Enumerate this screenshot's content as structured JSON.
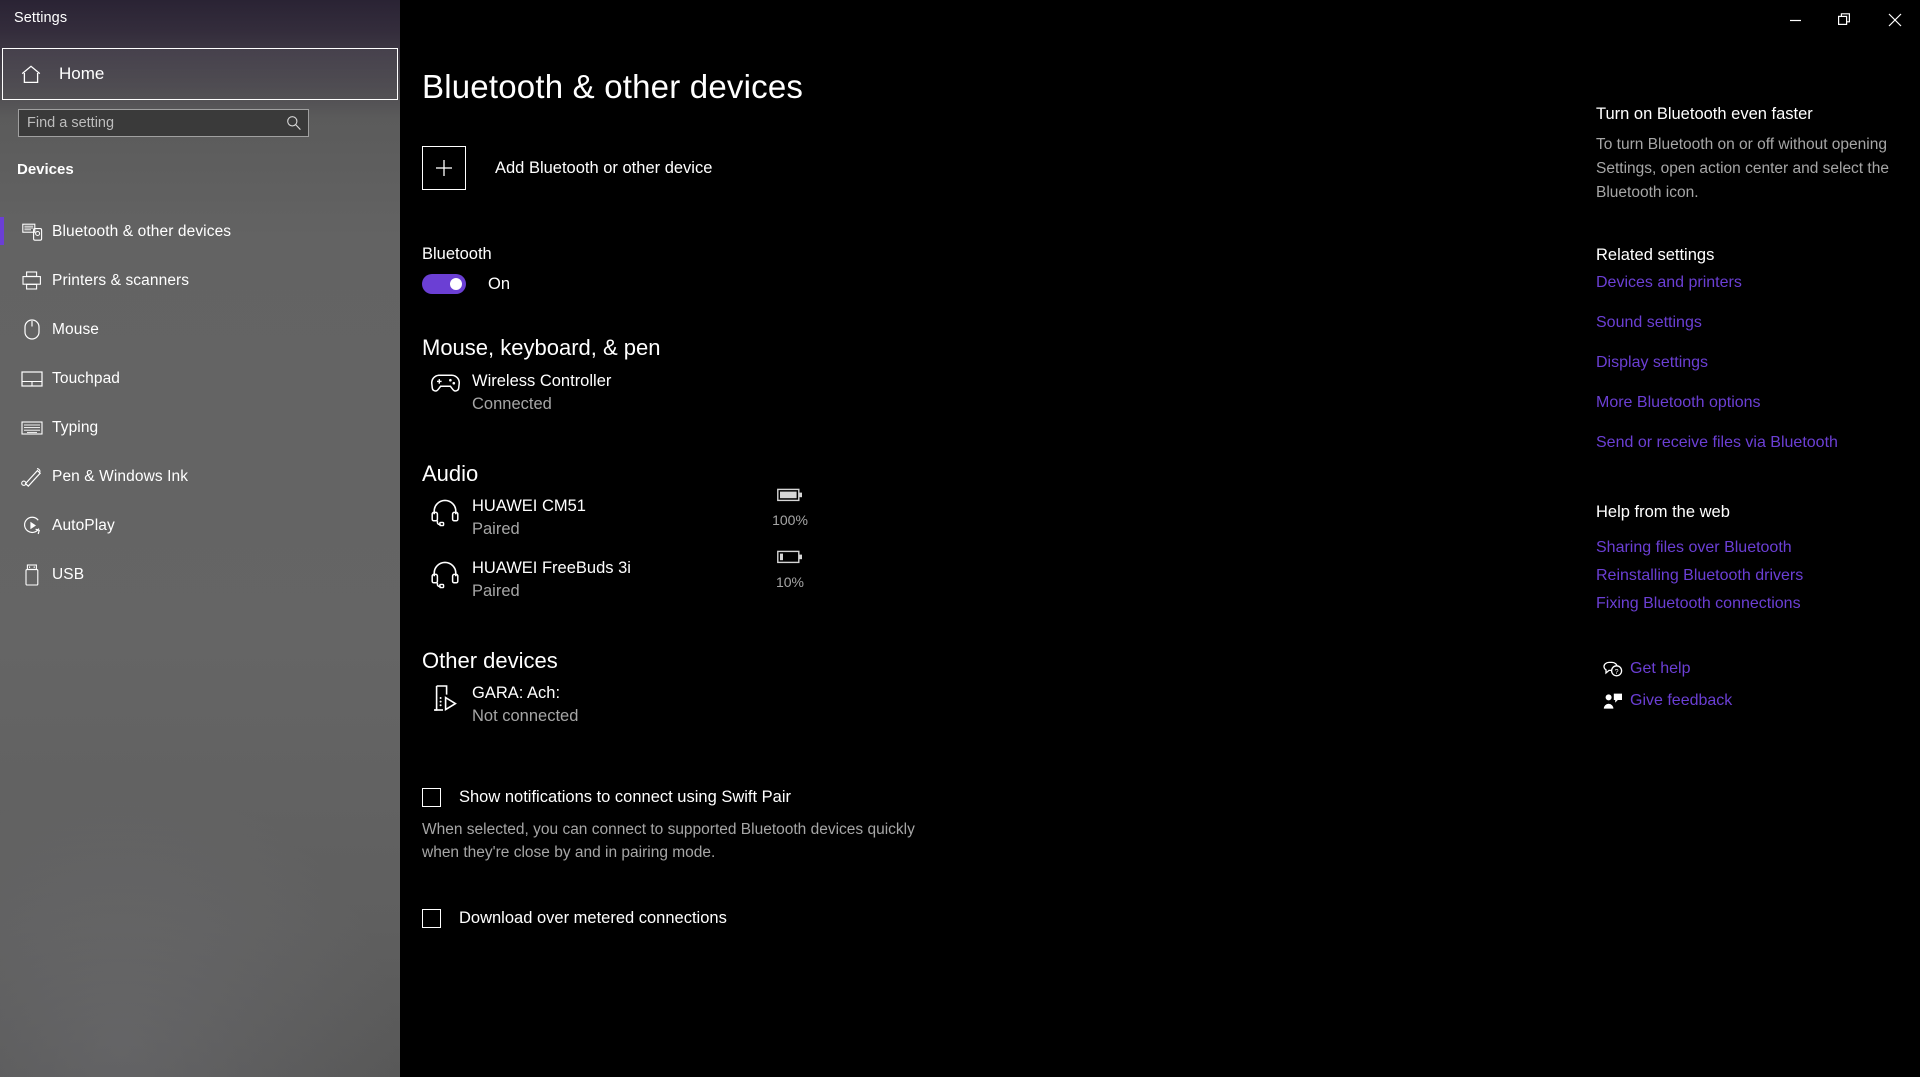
{
  "window": {
    "title": "Settings",
    "controls": [
      {
        "name": "minimize",
        "glyph": "minimize-icon"
      },
      {
        "name": "maximize",
        "glyph": "restore-icon"
      },
      {
        "name": "close",
        "glyph": "close-icon"
      }
    ]
  },
  "sidebar": {
    "home_label": "Home",
    "search_placeholder": "Find a setting",
    "search_value": "",
    "section_title": "Devices",
    "accent_color": "#6b3fd4",
    "items": [
      {
        "label": "Bluetooth & other devices",
        "icon": "bluetooth-devices-icon",
        "selected": true
      },
      {
        "label": "Printers & scanners",
        "icon": "printer-icon",
        "selected": false
      },
      {
        "label": "Mouse",
        "icon": "mouse-icon",
        "selected": false
      },
      {
        "label": "Touchpad",
        "icon": "touchpad-icon",
        "selected": false
      },
      {
        "label": "Typing",
        "icon": "keyboard-icon",
        "selected": false
      },
      {
        "label": "Pen & Windows Ink",
        "icon": "pen-icon",
        "selected": false
      },
      {
        "label": "AutoPlay",
        "icon": "autoplay-icon",
        "selected": false
      },
      {
        "label": "USB",
        "icon": "usb-icon",
        "selected": false
      }
    ]
  },
  "main": {
    "page_title": "Bluetooth & other devices",
    "add_device_label": "Add Bluetooth or other device",
    "bluetooth_label": "Bluetooth",
    "bluetooth_state": "On",
    "groups": [
      {
        "heading": "Mouse, keyboard, & pen",
        "devices": [
          {
            "name": "Wireless Controller",
            "status": "Connected",
            "icon": "gamepad-icon",
            "battery": null
          }
        ]
      },
      {
        "heading": "Audio",
        "devices": [
          {
            "name": "HUAWEI CM51",
            "status": "Paired",
            "icon": "headset-icon",
            "battery": "100%"
          },
          {
            "name": "HUAWEI FreeBuds 3i",
            "status": "Paired",
            "icon": "headset-icon",
            "battery": "10%"
          }
        ]
      },
      {
        "heading": "Other devices",
        "devices": [
          {
            "name": "GARA: Ach:",
            "status": "Not connected",
            "icon": "cast-device-icon",
            "battery": null
          }
        ]
      }
    ],
    "checkboxes": [
      {
        "label": "Show notifications to connect using Swift Pair",
        "checked": false,
        "description": "When selected, you can connect to supported Bluetooth devices quickly when they're close by and in pairing mode."
      },
      {
        "label": "Download over metered connections",
        "checked": false,
        "description": ""
      }
    ]
  },
  "right_panel": {
    "tip_heading": "Turn on Bluetooth even faster",
    "tip_body": "To turn Bluetooth on or off without opening Settings, open action center and select the Bluetooth icon.",
    "related_heading": "Related settings",
    "related_links": [
      "Devices and printers",
      "Sound settings",
      "Display settings",
      "More Bluetooth options",
      "Send or receive files via Bluetooth"
    ],
    "help_heading": "Help from the web",
    "help_links": [
      "Sharing files over Bluetooth",
      "Reinstalling Bluetooth drivers",
      "Fixing Bluetooth connections"
    ],
    "support_links": [
      {
        "label": "Get help",
        "icon": "get-help-icon"
      },
      {
        "label": "Give feedback",
        "icon": "feedback-icon"
      }
    ],
    "link_color": "#6b3fd4"
  }
}
